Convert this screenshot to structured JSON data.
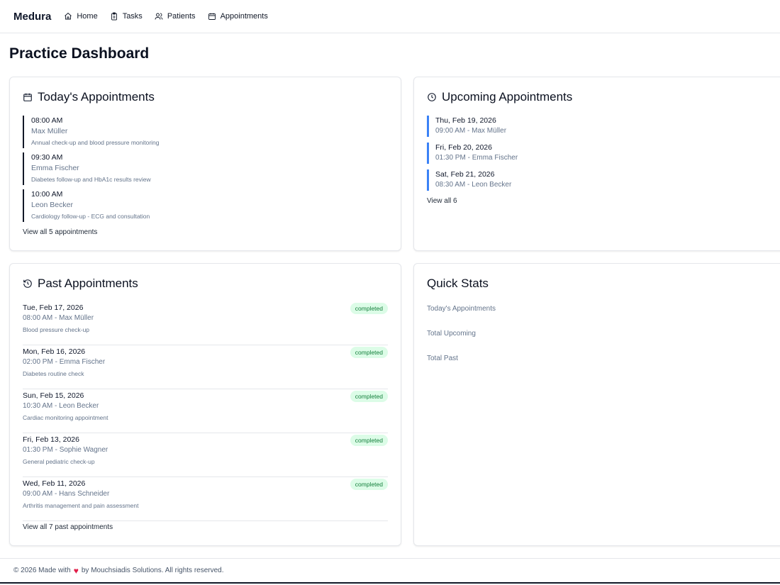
{
  "nav": {
    "brand": "Medura",
    "links": [
      {
        "label": "Home",
        "icon": "home-icon"
      },
      {
        "label": "Tasks",
        "icon": "clipboard-icon"
      },
      {
        "label": "Patients",
        "icon": "users-icon"
      },
      {
        "label": "Appointments",
        "icon": "calendar-icon"
      }
    ]
  },
  "page": {
    "title": "Practice Dashboard"
  },
  "today": {
    "title": "Today's Appointments",
    "items": [
      {
        "time": "08:00 AM",
        "patient": "Max Müller",
        "desc": "Annual check-up and blood pressure monitoring"
      },
      {
        "time": "09:30 AM",
        "patient": "Emma Fischer",
        "desc": "Diabetes follow-up and HbA1c results review"
      },
      {
        "time": "10:00 AM",
        "patient": "Leon Becker",
        "desc": "Cardiology follow-up - ECG and consultation"
      }
    ],
    "view_all": "View all 5 appointments"
  },
  "upcoming": {
    "title": "Upcoming Appointments",
    "items": [
      {
        "date": "Thu, Feb 19, 2026",
        "sub": "09:00 AM - Max Müller"
      },
      {
        "date": "Fri, Feb 20, 2026",
        "sub": "01:30 PM - Emma Fischer"
      },
      {
        "date": "Sat, Feb 21, 2026",
        "sub": "08:30 AM - Leon Becker"
      }
    ],
    "view_all": "View all 6"
  },
  "past": {
    "title": "Past Appointments",
    "items": [
      {
        "date": "Tue, Feb 17, 2026",
        "sub": "08:00 AM - Max Müller",
        "desc": "Blood pressure check-up",
        "status": "completed"
      },
      {
        "date": "Mon, Feb 16, 2026",
        "sub": "02:00 PM - Emma Fischer",
        "desc": "Diabetes routine check",
        "status": "completed"
      },
      {
        "date": "Sun, Feb 15, 2026",
        "sub": "10:30 AM - Leon Becker",
        "desc": "Cardiac monitoring appointment",
        "status": "completed"
      },
      {
        "date": "Fri, Feb 13, 2026",
        "sub": "01:30 PM - Sophie Wagner",
        "desc": "General pediatric check-up",
        "status": "completed"
      },
      {
        "date": "Wed, Feb 11, 2026",
        "sub": "09:00 AM - Hans Schneider",
        "desc": "Arthritis management and pain assessment",
        "status": "completed"
      }
    ],
    "view_all": "View all 7 past appointments"
  },
  "stats": {
    "title": "Quick Stats",
    "items": [
      "Today's Appointments",
      "Total Upcoming",
      "Total Past"
    ]
  },
  "footer": {
    "before": "© 2026 Made with",
    "heart": "♥",
    "after": "by Mouchsiadis Solutions. All rights reserved."
  },
  "colors": {
    "accent_upcoming": "#3b82f6",
    "badge_bg": "#dcfce7",
    "badge_text": "#15803d",
    "heart": "#e11d48"
  }
}
